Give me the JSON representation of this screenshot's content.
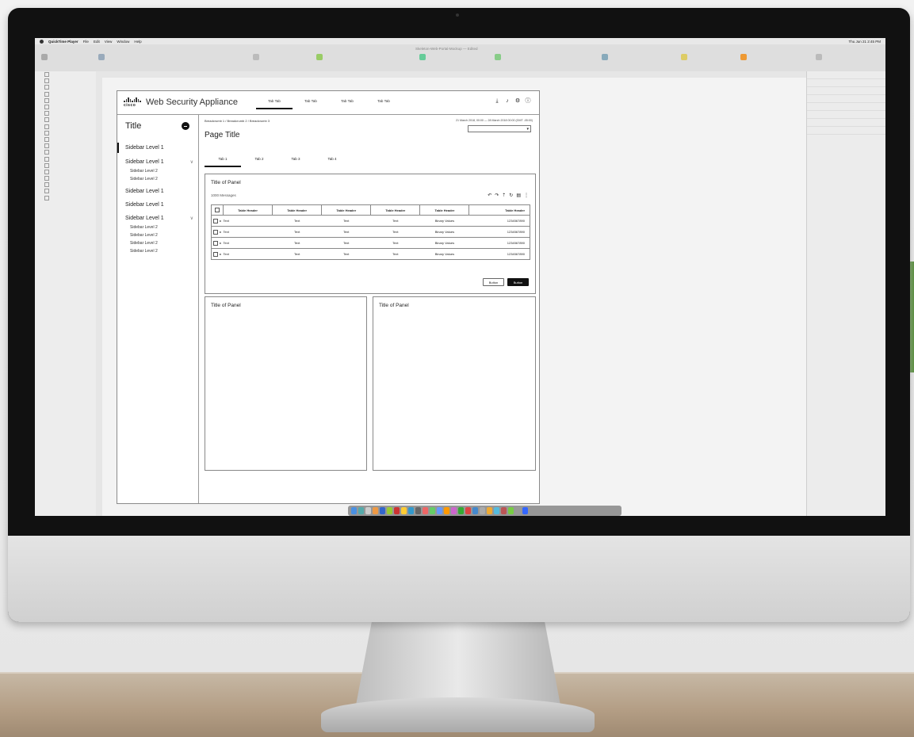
{
  "mac_menubar": {
    "app": "QuickTime Player",
    "menus": [
      "File",
      "Edit",
      "View",
      "Window",
      "Help"
    ],
    "clock": "Thu Jun 21 2:45 PM"
  },
  "sketch": {
    "document_title": "Skeleton-Web-Portal-Mockup — Edited"
  },
  "artboard": {
    "logo_text": "cisco",
    "app_name": "Web Security Appliance",
    "top_tabs": [
      "Tab Tab",
      "Tab Tab",
      "Tab Tab",
      "Tab Tab"
    ],
    "header_icons": [
      "download-icon",
      "bell-icon",
      "gear-icon",
      "info-icon"
    ],
    "sidebar": {
      "title": "Title",
      "items": [
        {
          "label": "Sidebar Level 1",
          "active": true
        },
        {
          "label": "Sidebar Level 1",
          "expand": "∨",
          "children": [
            "Sidebar Level 2",
            "Sidebar Level 2"
          ]
        },
        {
          "label": "Sidebar Level 1"
        },
        {
          "label": "Sidebar Level 1"
        },
        {
          "label": "Sidebar Level 1",
          "expand": "∨",
          "children": [
            "Sidebar Level 2",
            "Sidebar Level 2",
            "Sidebar Level 2",
            "Sidebar Level 2"
          ]
        }
      ]
    },
    "breadcrumb": "Breadcrumb 1 / Breadcrumb 2 / Breadcrumb 3",
    "date_range": "21 March 2018, 00:00 — 28 March 2018 00:00 (GMT -05:00)",
    "page_title": "Page Title",
    "tabs": [
      "Tab 1",
      "Tab 2",
      "Tab 3",
      "Tab 4"
    ],
    "panel_main": {
      "title": "Title of Panel",
      "count": "1000 Messages",
      "headers": [
        "Table Header",
        "Table Header",
        "Table Header",
        "Table Header",
        "Table Header",
        "Table Header"
      ],
      "rows": [
        [
          "Text",
          "Text",
          "Text",
          "Text",
          "Binary Values",
          "1234567890"
        ],
        [
          "Text",
          "Text",
          "Text",
          "Text",
          "Binary Values",
          "1234567890"
        ],
        [
          "Text",
          "Text",
          "Text",
          "Text",
          "Binary Values",
          "1234567890"
        ],
        [
          "Text",
          "Text",
          "Text",
          "Text",
          "Binary Values",
          "1234567890"
        ]
      ],
      "button_secondary": "Button",
      "button_primary": "Button"
    },
    "panel_left": {
      "title": "Title of Panel"
    },
    "panel_right": {
      "title": "Title of Panel"
    }
  }
}
